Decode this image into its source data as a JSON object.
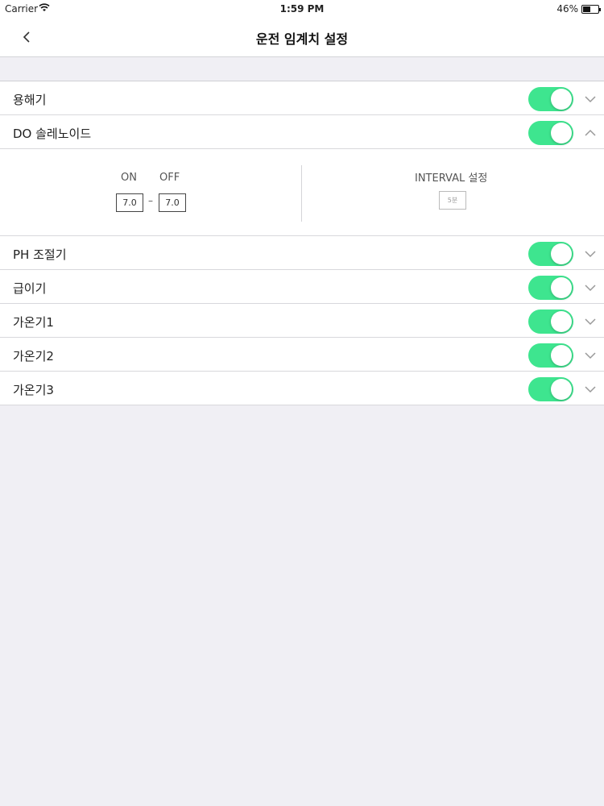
{
  "status_bar": {
    "carrier": "Carrier",
    "time": "1:59 PM",
    "battery": "46%"
  },
  "nav": {
    "title": "운전 임계치 설정"
  },
  "settings": [
    {
      "label": "용해기",
      "enabled": true,
      "expanded": false
    },
    {
      "label": "DO 솔레노이드",
      "enabled": true,
      "expanded": true
    },
    {
      "label": "PH 조절기",
      "enabled": true,
      "expanded": false
    },
    {
      "label": "급이기",
      "enabled": true,
      "expanded": false
    },
    {
      "label": "가온기1",
      "enabled": true,
      "expanded": false
    },
    {
      "label": "가온기2",
      "enabled": true,
      "expanded": false
    },
    {
      "label": "가온기3",
      "enabled": true,
      "expanded": false
    }
  ],
  "do_detail": {
    "on_label": "ON",
    "off_label": "OFF",
    "on_value": "7.0",
    "off_value": "7.0",
    "separator": "–",
    "interval_label": "INTERVAL 설정",
    "interval_value": "5분"
  },
  "colors": {
    "toggle_on": "#3ee58f",
    "background": "#f0eff4"
  }
}
